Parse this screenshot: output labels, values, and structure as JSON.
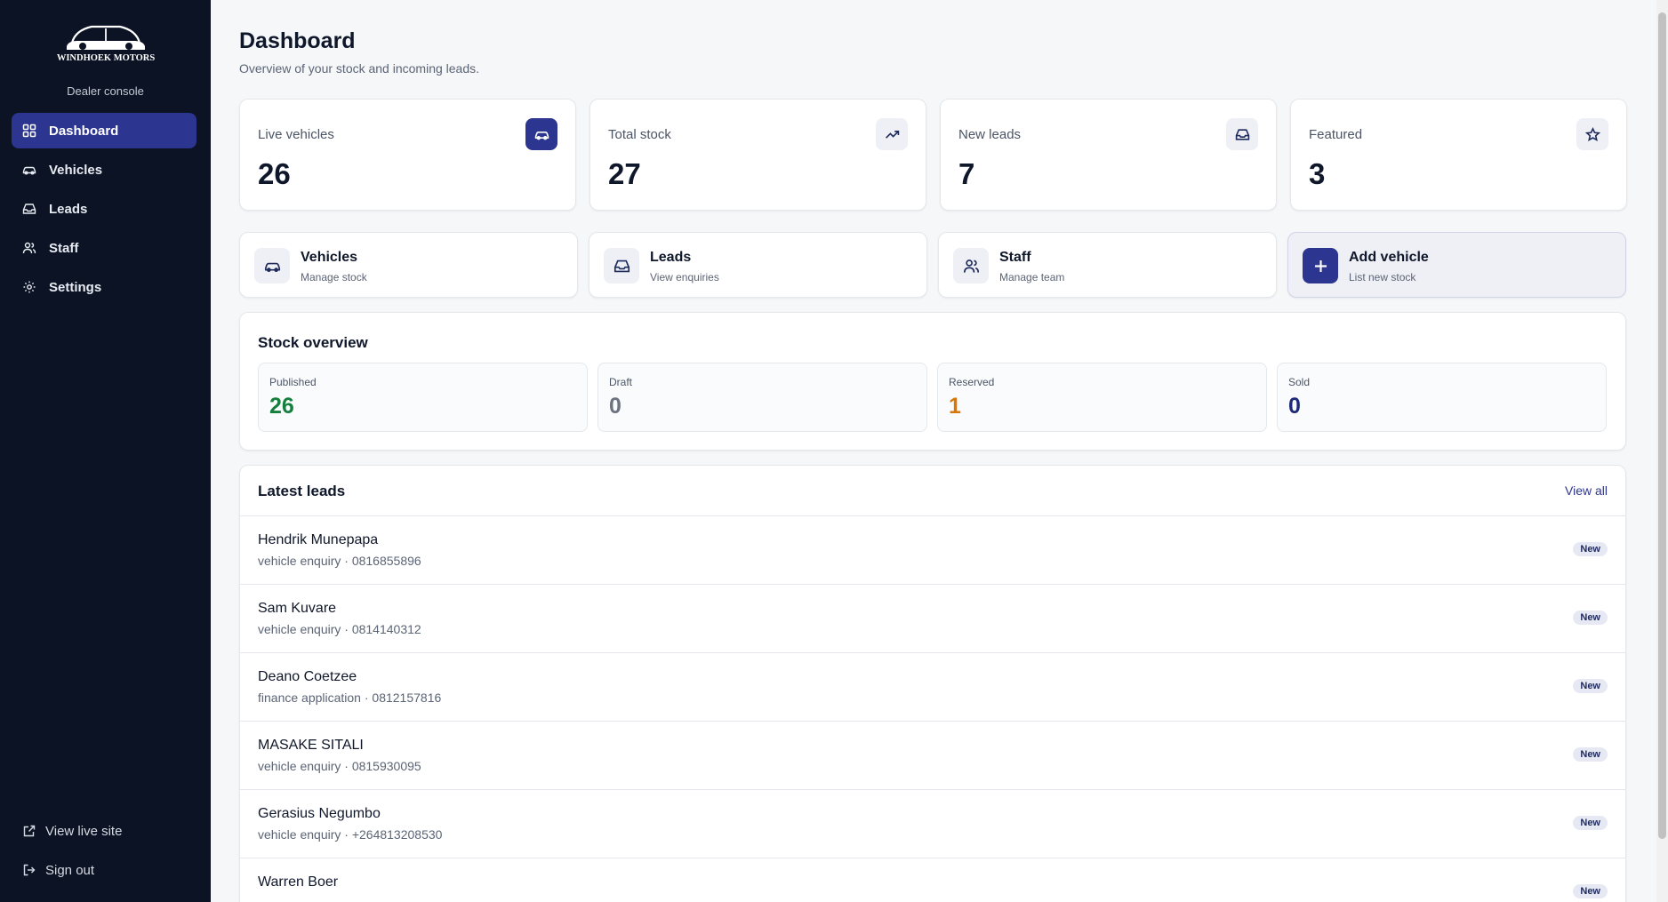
{
  "sidebar": {
    "brand_name": "WINDHOEK MOTORS",
    "brand_sub": "Dealer console",
    "items": [
      {
        "label": "Dashboard",
        "icon": "dashboard-icon",
        "active": true
      },
      {
        "label": "Vehicles",
        "icon": "car-icon"
      },
      {
        "label": "Leads",
        "icon": "inbox-icon"
      },
      {
        "label": "Staff",
        "icon": "users-icon"
      },
      {
        "label": "Settings",
        "icon": "gear-icon"
      }
    ],
    "bottom": [
      {
        "label": "View live site",
        "icon": "external-link-icon"
      },
      {
        "label": "Sign out",
        "icon": "logout-icon"
      }
    ]
  },
  "header": {
    "title": "Dashboard",
    "subtitle": "Overview of your stock and incoming leads."
  },
  "stats": [
    {
      "label": "Live vehicles",
      "value": "26",
      "icon": "car-icon"
    },
    {
      "label": "Total stock",
      "value": "27",
      "icon": "trending-up-icon"
    },
    {
      "label": "New leads",
      "value": "7",
      "icon": "inbox-icon"
    },
    {
      "label": "Featured",
      "value": "3",
      "icon": "star-icon"
    }
  ],
  "quick_links": [
    {
      "title": "Vehicles",
      "sub": "Manage stock",
      "icon": "car-icon"
    },
    {
      "title": "Leads",
      "sub": "View enquiries",
      "icon": "inbox-icon"
    },
    {
      "title": "Staff",
      "sub": "Manage team",
      "icon": "users-icon"
    },
    {
      "title": "Add vehicle",
      "sub": "List new stock",
      "icon": "plus-icon"
    }
  ],
  "stock_overview": {
    "title": "Stock overview",
    "items": [
      {
        "label": "Published",
        "value": "26",
        "color": "#15803d"
      },
      {
        "label": "Draft",
        "value": "0",
        "color": "#6b7280"
      },
      {
        "label": "Reserved",
        "value": "1",
        "color": "#d97706"
      },
      {
        "label": "Sold",
        "value": "0",
        "color": "#1e2a78"
      }
    ]
  },
  "leads": {
    "title": "Latest leads",
    "view_all": "View all",
    "rows": [
      {
        "name": "Hendrik Munepapa",
        "meta": "vehicle enquiry · 0816855896",
        "badge": "New"
      },
      {
        "name": "Sam Kuvare",
        "meta": "vehicle enquiry · 0814140312",
        "badge": "New"
      },
      {
        "name": "Deano Coetzee",
        "meta": "finance application · 0812157816",
        "badge": "New"
      },
      {
        "name": "MASAKE SITALI",
        "meta": "vehicle enquiry · 0815930095",
        "badge": "New"
      },
      {
        "name": "Gerasius Negumbo",
        "meta": "vehicle enquiry · +264813208530",
        "badge": "New"
      },
      {
        "name": "Warren Boer",
        "meta": "",
        "badge": "New"
      }
    ]
  },
  "colors": {
    "sidebar_bg": "#0b1324",
    "accent": "#2c3590"
  }
}
